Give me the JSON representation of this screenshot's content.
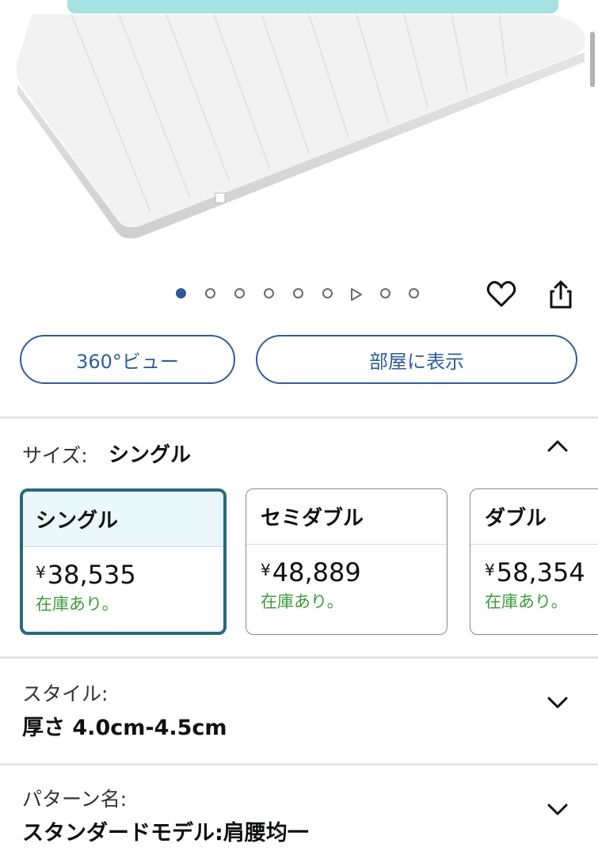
{
  "gallery": {
    "total_slides": 9,
    "active_index": 0,
    "video_index": 6
  },
  "actions": {
    "view_360_label": "360°ビュー",
    "view_in_room_label": "部屋に表示"
  },
  "size": {
    "label": "サイズ:",
    "selected": "シングル",
    "options": [
      {
        "name": "シングル",
        "currency": "¥",
        "price": "38,535",
        "stock": "在庫あり。",
        "selected": true
      },
      {
        "name": "セミダブル",
        "currency": "¥",
        "price": "48,889",
        "stock": "在庫あり。",
        "selected": false
      },
      {
        "name": "ダブル",
        "currency": "¥",
        "price": "58,354",
        "stock": "在庫あり。",
        "selected": false
      }
    ]
  },
  "style": {
    "label": "スタイル:",
    "value": "厚さ 4.0cm-4.5cm"
  },
  "pattern": {
    "label": "パターン名:",
    "value": "スタンダードモデル:肩腰均一"
  },
  "colors": {
    "accent": "#2f5d9c",
    "selected_border": "#276a7c",
    "stock_green": "#3d9b3d"
  }
}
